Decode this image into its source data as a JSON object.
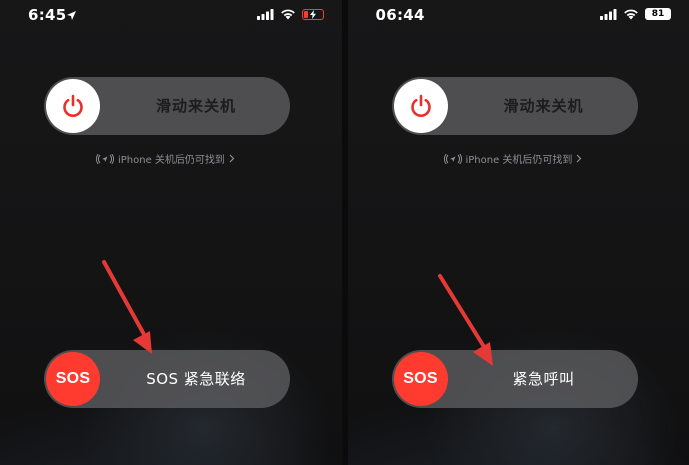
{
  "left_screen": {
    "status": {
      "time": "6:45"
    },
    "power_slider": {
      "label": "滑动来关机"
    },
    "find_my_hint": "iPhone 关机后仍可找到",
    "sos_slider": {
      "knob_label": "SOS",
      "label": "SOS 紧急联络"
    }
  },
  "right_screen": {
    "status": {
      "time": "06:44",
      "battery_percent": "81"
    },
    "power_slider": {
      "label": "滑动来关机"
    },
    "find_my_hint": "iPhone 关机后仍可找到",
    "sos_slider": {
      "knob_label": "SOS",
      "label": "紧急呼叫"
    }
  },
  "icons": [
    "location-arrow-icon",
    "cellular-signal-icon",
    "wifi-icon",
    "battery-icon",
    "power-icon",
    "find-my-icon",
    "chevron-right-icon"
  ],
  "colors": {
    "sos_red": "#ff3b30",
    "power_red": "#e8302a",
    "annotation_red": "#e53935",
    "low_battery_red": "#ff3b30"
  }
}
